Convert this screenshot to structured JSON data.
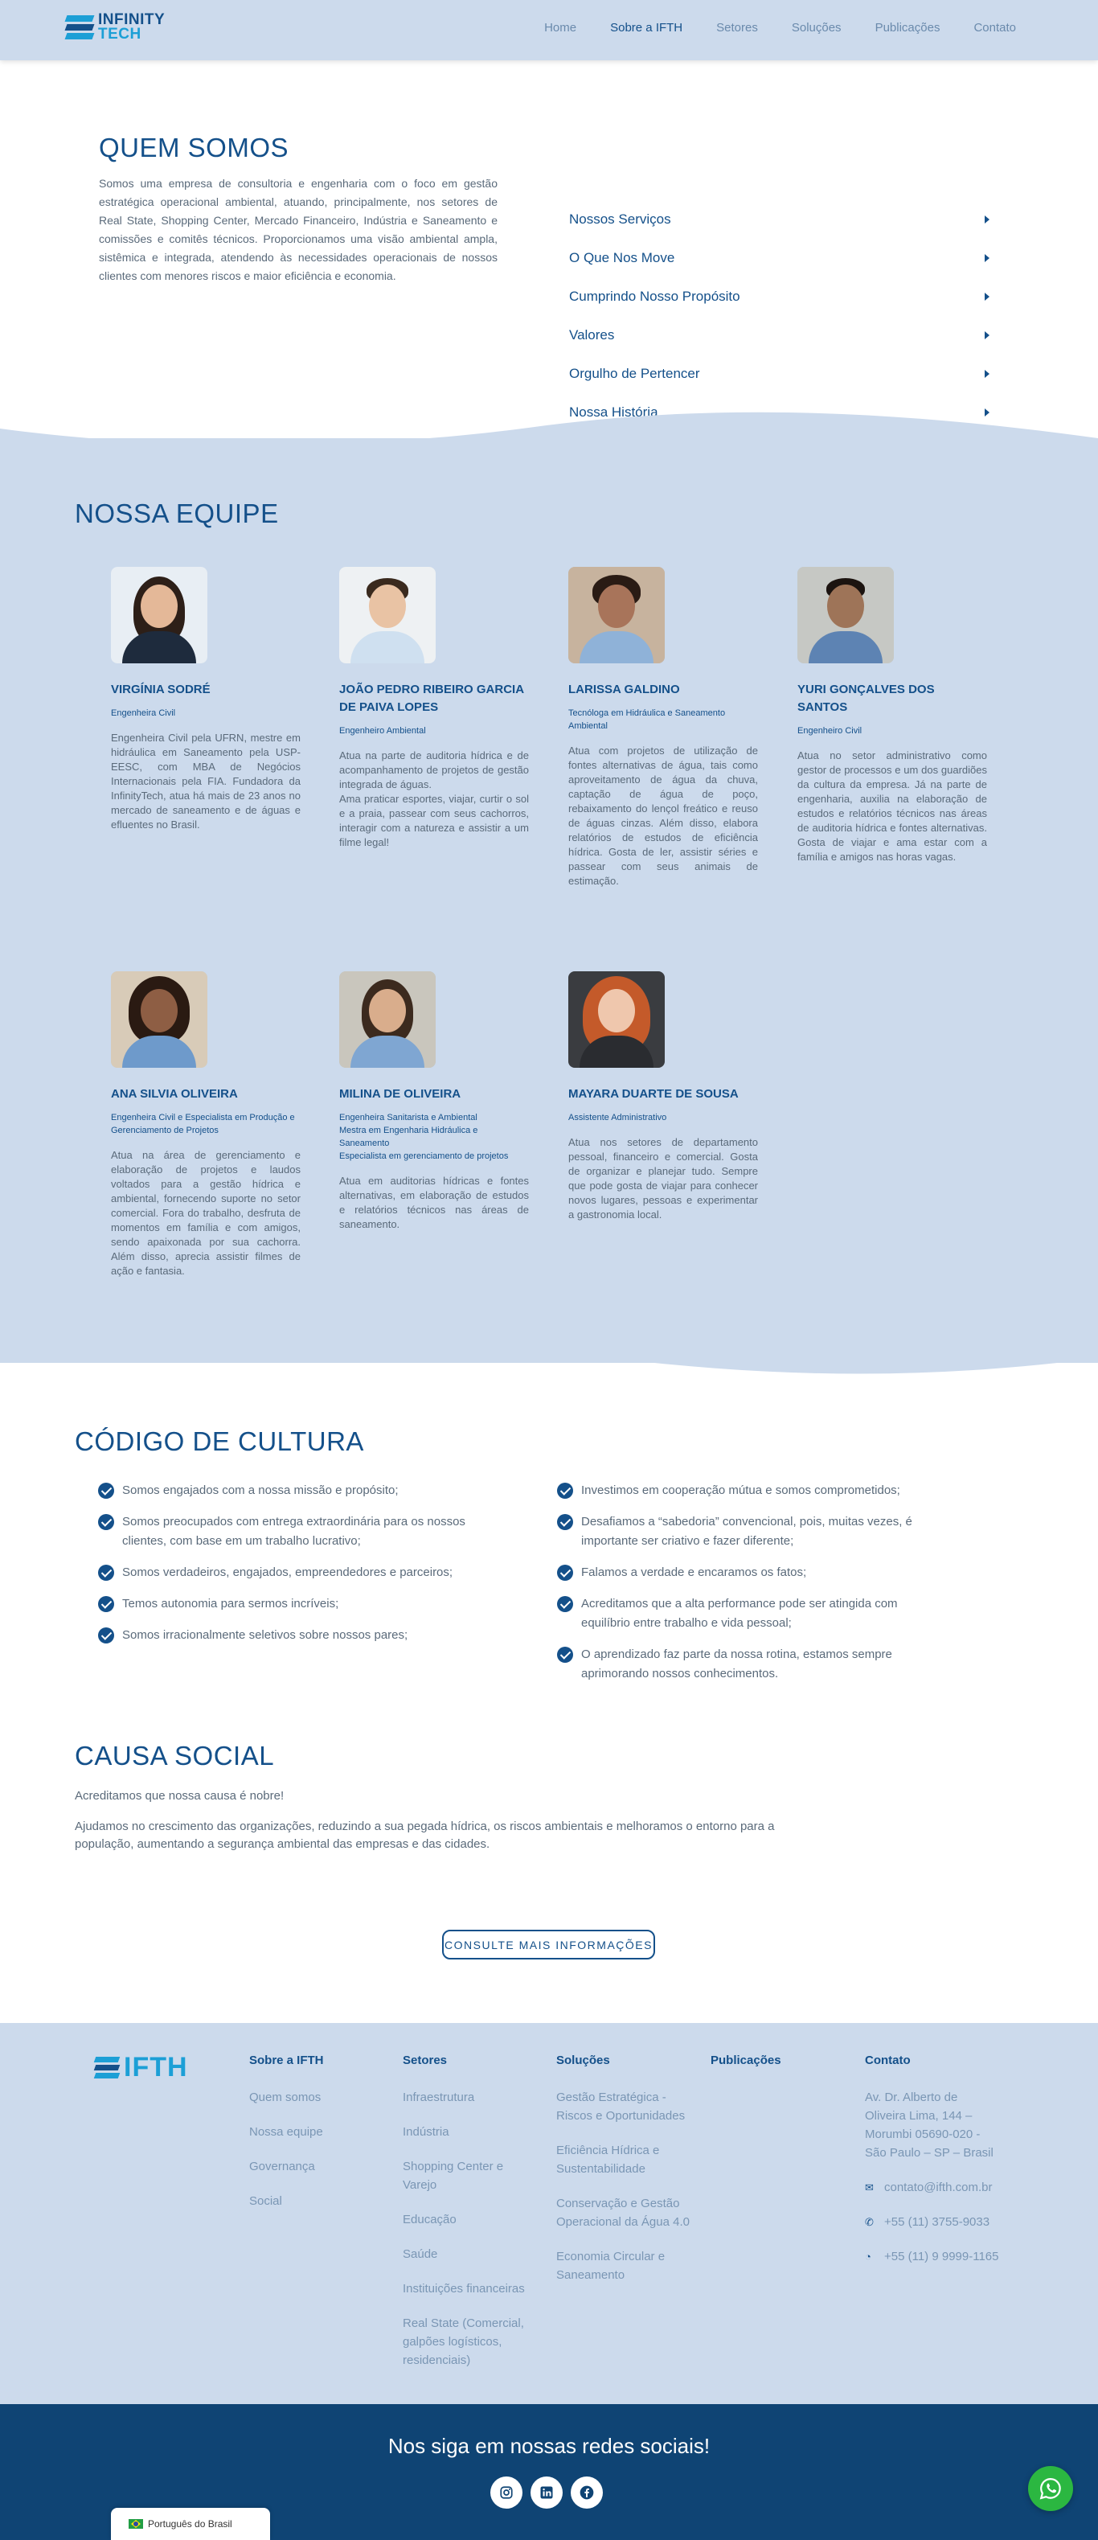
{
  "header": {
    "logo_line1": "INFINITY",
    "logo_line2": "TECH",
    "nav": [
      {
        "label": "Home"
      },
      {
        "label": "Sobre a IFTH",
        "active": true
      },
      {
        "label": "Setores"
      },
      {
        "label": "Soluções"
      },
      {
        "label": "Publicações"
      },
      {
        "label": "Contato"
      }
    ]
  },
  "quem_somos": {
    "title": "QUEM SOMOS",
    "text": "Somos uma empresa de consultoria e engenharia com o foco em gestão estratégica operacional ambiental, atuando, principalmente, nos setores de Real State, Shopping Center, Mercado Financeiro, Indústria e Saneamento e comissões e comitês técnicos. Proporcionamos uma visão ambiental ampla, sistêmica e integrada, atendendo às necessidades operacionais de nossos clientes com menores riscos e maior eficiência e economia.",
    "accordion": [
      "Nossos Serviços",
      "O Que Nos Move",
      "Cumprindo Nosso Propósito",
      "Valores",
      "Orgulho de Pertencer",
      "Nossa História"
    ]
  },
  "equipe": {
    "title": "NOSSA EQUIPE",
    "members": [
      {
        "name": "VIRGÍNIA SODRÉ",
        "role": "Engenheira Civil",
        "desc": "Engenheira Civil pela UFRN, mestre em hidráulica em Saneamento pela USP-EESC, com MBA de Negócios Internacionais pela FIA. Fundadora da InfinityTech, atua há mais de 23 anos no mercado de saneamento e de águas e efluentes no Brasil."
      },
      {
        "name": "JOÃO PEDRO RIBEIRO GARCIA DE PAIVA LOPES",
        "role": "Engenheiro Ambiental",
        "desc": "Atua na parte de auditoria hídrica e de acompanhamento de projetos de gestão integrada de águas.\nAma praticar esportes, viajar, curtir o sol e a praia, passear com seus cachorros, interagir com a natureza e assistir a um filme legal!"
      },
      {
        "name": "LARISSA GALDINO",
        "role": "Tecnóloga em Hidráulica e Saneamento Ambiental",
        "desc": "Atua com projetos de utilização de fontes alternativas de água, tais como aproveitamento de água da chuva, captação de água de poço, rebaixamento do lençol freático e reuso de águas cinzas. Além disso, elabora relatórios de estudos de eficiência hídrica. Gosta de ler, assistir séries e passear com seus animais de estimação."
      },
      {
        "name": "YURI GONÇALVES DOS SANTOS",
        "role": "Engenheiro Civil",
        "desc": "Atua no setor administrativo como gestor de processos e um dos guardiões da cultura da empresa. Já na parte de engenharia, auxilia na elaboração de estudos e relatórios técnicos nas áreas de auditoria hídrica e fontes alternativas. Gosta de viajar e ama estar com a família e amigos nas horas vagas."
      },
      {
        "name": "ANA SILVIA OLIVEIRA",
        "role": "Engenheira Civil e Especialista em Produção e Gerenciamento de Projetos",
        "desc": "Atua na área de gerenciamento e elaboração de projetos e laudos voltados para a gestão hídrica e ambiental, fornecendo suporte no setor comercial. Fora do trabalho, desfruta de momentos em família e com amigos, sendo apaixonada por sua cachorra. Além disso, aprecia assistir filmes de ação e fantasia."
      },
      {
        "name": "MILINA DE OLIVEIRA",
        "role": "Engenheira Sanitarista e Ambiental\nMestra em Engenharia Hidráulica e Saneamento\nEspecialista em gerenciamento de projetos",
        "desc": "Atua em auditorias hídricas e fontes alternativas, em elaboração de estudos e relatórios técnicos nas áreas de saneamento."
      },
      {
        "name": "MAYARA DUARTE DE SOUSA",
        "role": "Assistente Administrativo",
        "desc": "Atua nos setores de departamento pessoal, financeiro e comercial. Gosta de organizar e planejar tudo. Sempre que pode gosta de viajar para conhecer novos lugares, pessoas e experimentar a gastronomia local."
      }
    ]
  },
  "cultura": {
    "title": "CÓDIGO DE CULTURA",
    "left": [
      "Somos engajados com a nossa missão e propósito;",
      "Somos preocupados com entrega extraordinária para os nossos clientes, com base em um trabalho lucrativo;",
      "Somos verdadeiros, engajados, empreendedores e parceiros;",
      "Temos autonomia para sermos incríveis;",
      "Somos irracionalmente seletivos sobre nossos pares;"
    ],
    "right": [
      "Investimos em cooperação mútua e somos comprometidos;",
      "Desafiamos a “sabedoria” convencional, pois, muitas vezes, é importante ser criativo e fazer diferente;",
      "Falamos a verdade e encaramos os fatos;",
      "Acreditamos que a alta performance pode ser atingida com equilíbrio entre trabalho e vida pessoal;",
      "O aprendizado faz parte da nossa rotina, estamos sempre aprimorando nossos conhecimentos."
    ]
  },
  "causa": {
    "title": "CAUSA SOCIAL",
    "text1": "Acreditamos que nossa causa é nobre!",
    "text2": "Ajudamos no crescimento das organizações, reduzindo a sua pegada hídrica, os riscos ambientais e melhoramos o entorno para a população, aumentando a segurança ambiental das empresas e das cidades.",
    "cta": "CONSULTE MAIS INFORMAÇÕES"
  },
  "footer": {
    "logo": "IFTH",
    "columns": [
      {
        "title": "Sobre a IFTH",
        "links": [
          "Quem somos",
          "Nossa equipe",
          "Governança",
          "Social"
        ]
      },
      {
        "title": "Setores",
        "links": [
          "Infraestrutura",
          "Indústria",
          "Shopping Center e Varejo",
          "Educação",
          "Saúde",
          "Instituições financeiras",
          "Real State (Comercial, galpões logísticos, residenciais)"
        ]
      },
      {
        "title": "Soluções",
        "links": [
          "Gestão Estratégica - Riscos e Oportunidades",
          "Eficiência Hídrica e Sustentabilidade",
          "Conservação e Gestão Operacional da Água 4.0",
          "Economia Circular e Saneamento"
        ]
      },
      {
        "title": "Publicações",
        "links": []
      }
    ],
    "contact": {
      "title": "Contato",
      "address": "Av. Dr. Alberto de Oliveira Lima, 144 – Morumbi 05690-020 - São Paulo – SP – Brasil",
      "email": "contato@ifth.com.br",
      "phone": "+55 (11) 3755-9033",
      "whatsapp": "+55 (11) 9 9999-1165"
    }
  },
  "social": {
    "title": "Nos siga em nossas redes sociais!",
    "language": "Português do Brasil"
  },
  "colors": {
    "brand_dark": "#14508a",
    "brand_light": "#1c9fd6",
    "section_bg": "#ccdaec",
    "social_bg": "#0f4474",
    "whatsapp": "#2bb741"
  }
}
